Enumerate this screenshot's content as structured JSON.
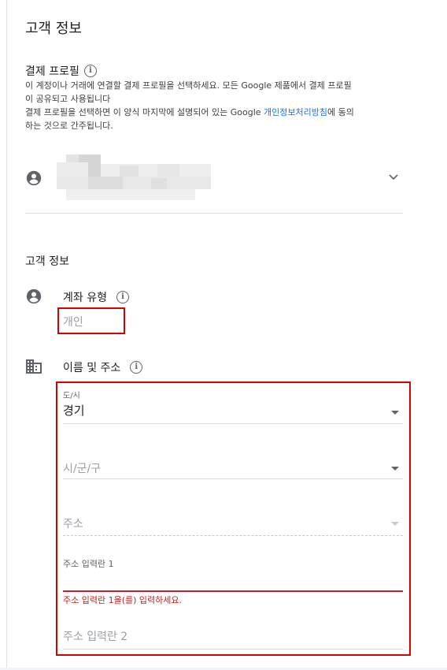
{
  "page_title": "고객 정보",
  "payment_profile": {
    "heading": "결제 프로필",
    "desc_line1": "이 계정이나 거래에 연결할 결제 프로필을 선택하세요. 모든 Google 제품에서 결제 프로필",
    "desc_line2": "이 공유되고 사용됩니다",
    "desc_line3_pre": "결제 프로필을 선택하면 이 양식 마지막에 설명되어 있는 Google ",
    "desc_line3_link": "개인정보처리방침",
    "desc_line3_post": "에 동의",
    "desc_line4": "하는 것으로 간주됩니다."
  },
  "customer_info": {
    "section_title": "고객 정보",
    "account_type_label": "계좌 유형",
    "account_type_value": "개인",
    "name_address_label": "이름 및 주소",
    "state_label": "도/시",
    "state_value": "경기",
    "city_placeholder": "시/군/구",
    "district_placeholder": "주소",
    "address1_label": "주소 입력란 1",
    "address1_error": "주소 입력란 1을(를) 입력하세요.",
    "address2_placeholder": "주소 입력란 2"
  },
  "colors": {
    "accent": "#1a73e8",
    "error": "#c5221f",
    "highlight_box": "#d50000"
  }
}
